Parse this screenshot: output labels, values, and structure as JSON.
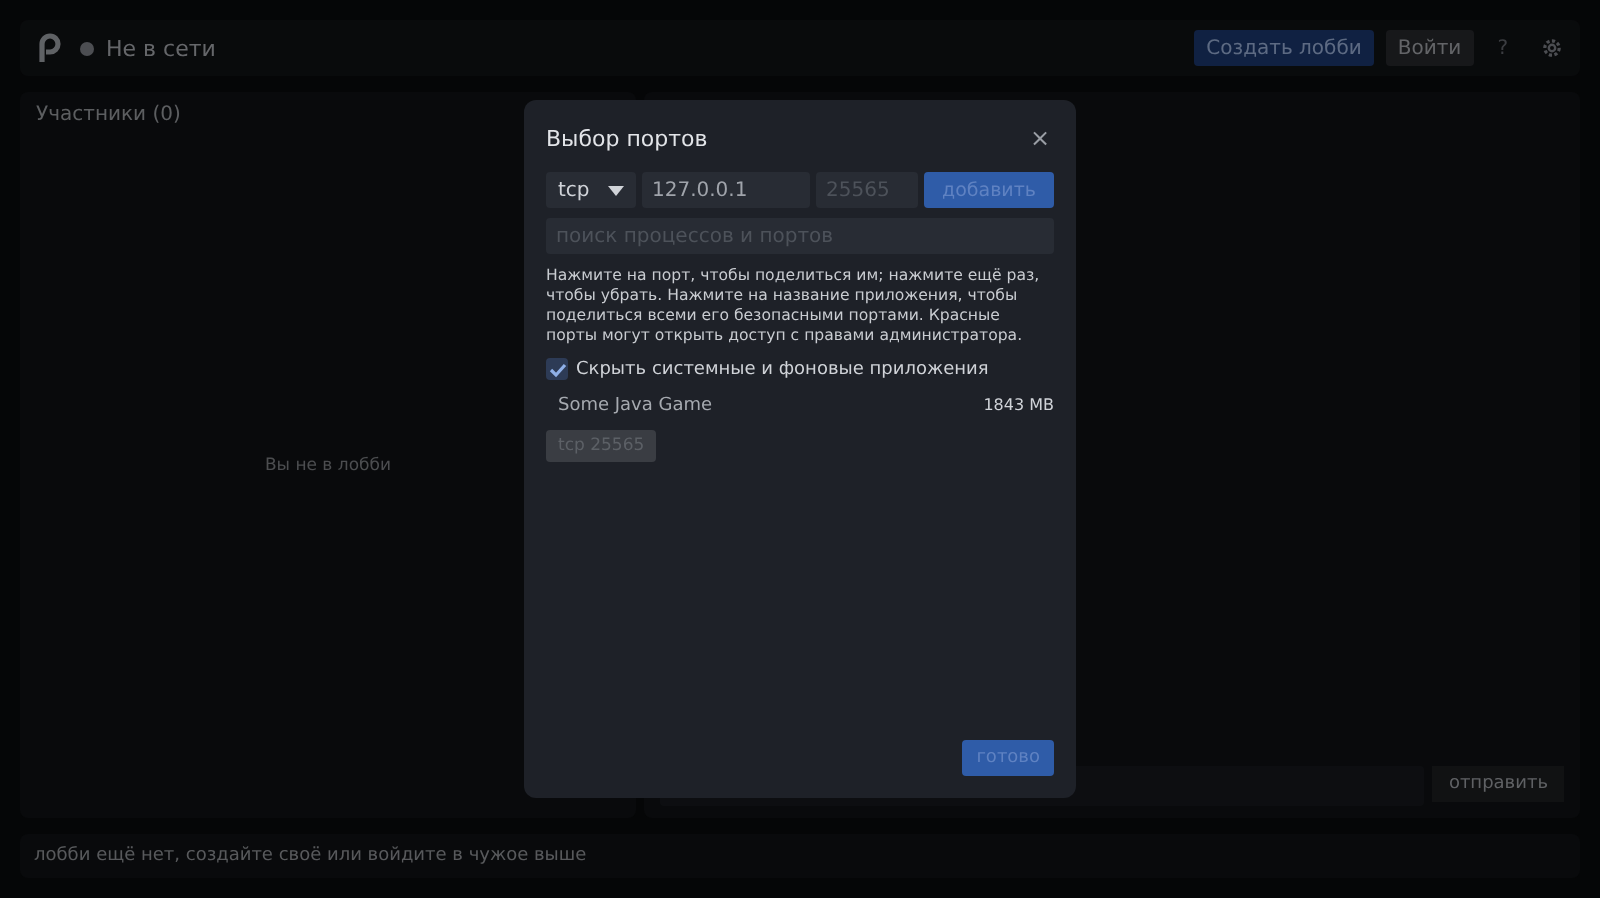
{
  "top_bar": {
    "status": "Не в сети",
    "buttons": [
      {
        "label": "Создать лобби",
        "kind": "primary"
      },
      {
        "label": "Войти",
        "kind": "secondary"
      }
    ],
    "help": "?"
  },
  "members_panel": {
    "title": "Участники (0)",
    "empty_text": "Вы не в лобби"
  },
  "chat": {
    "send_button": "отправить"
  },
  "status_bar": "лобби ещё нет, создайте своё или войдите в чужое выше",
  "dialog": {
    "title": "Выбор портов",
    "close": "×",
    "protocol": "tcp",
    "address": "127.0.0.1",
    "port_placeholder": "25565",
    "add_button": "добавить",
    "search_placeholder": "поиск процессов и портов",
    "help_text": "Нажмите на порт, чтобы поделиться им; нажмите ещё раз, чтобы убрать. Нажмите на название приложения, чтобы поделиться всеми его безопасными портами. Красные порты могут открыть доступ с правами администратора.",
    "hide_system": {
      "label": "Скрыть системные и фоновые приложения",
      "checked": true
    },
    "apps": [
      {
        "name": "Some Java Game",
        "memory": "1843 MB",
        "ports": [
          {
            "label": "tcp 25565",
            "selected": false
          }
        ]
      }
    ],
    "done_button": "готово"
  }
}
